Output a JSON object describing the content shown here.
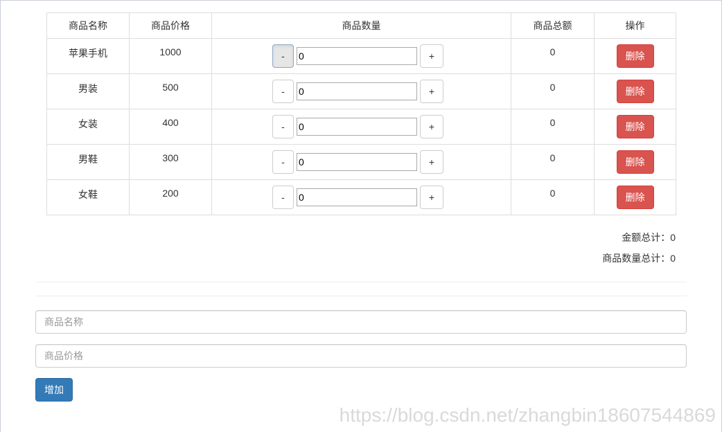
{
  "table": {
    "headers": [
      "商品名称",
      "商品价格",
      "商品数量",
      "商品总额",
      "操作"
    ],
    "rows": [
      {
        "name": "苹果手机",
        "price": "1000",
        "qty": "0",
        "total": "0"
      },
      {
        "name": "男装",
        "price": "500",
        "qty": "0",
        "total": "0"
      },
      {
        "name": "女装",
        "price": "400",
        "qty": "0",
        "total": "0"
      },
      {
        "name": "男鞋",
        "price": "300",
        "qty": "0",
        "total": "0"
      },
      {
        "name": "女鞋",
        "price": "200",
        "qty": "0",
        "total": "0"
      }
    ],
    "minus_label": "-",
    "plus_label": "+",
    "delete_label": "删除"
  },
  "summary": {
    "amount_total": "金额总计：0",
    "qty_total": "商品数量总计：0"
  },
  "form": {
    "name_placeholder": "商品名称",
    "price_placeholder": "商品价格",
    "add_label": "增加"
  },
  "watermark": "https://blog.csdn.net/zhangbin18607544869",
  "colors": {
    "danger": "#d9534f",
    "primary": "#337ab7",
    "border": "#dddddd"
  }
}
